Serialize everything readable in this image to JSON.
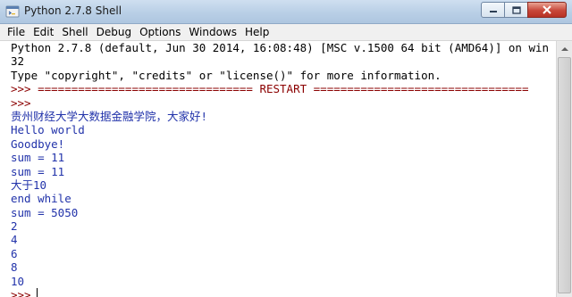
{
  "window": {
    "title": "Python 2.7.8 Shell",
    "icon": "python-shell-icon"
  },
  "menu": [
    "File",
    "Edit",
    "Shell",
    "Debug",
    "Options",
    "Windows",
    "Help"
  ],
  "shell_lines": [
    {
      "text": "Python 2.7.8 (default, Jun 30 2014, 16:08:48) [MSC v.1500 64 bit (AMD64)] on win",
      "kind": "banner"
    },
    {
      "text": "32",
      "kind": "banner"
    },
    {
      "text": "Type \"copyright\", \"credits\" or \"license()\" for more information.",
      "kind": "banner"
    },
    {
      "text": ">>> ================================ RESTART ================================",
      "kind": "prompt"
    },
    {
      "text": ">>>",
      "kind": "prompt"
    },
    {
      "text": "贵州财经大学大数据金融学院，大家好!",
      "kind": "output"
    },
    {
      "text": "Hello world",
      "kind": "output"
    },
    {
      "text": "Goodbye!",
      "kind": "output"
    },
    {
      "text": "sum = 11",
      "kind": "output"
    },
    {
      "text": "sum = 11",
      "kind": "output"
    },
    {
      "text": "大于10",
      "kind": "output"
    },
    {
      "text": "end while",
      "kind": "output"
    },
    {
      "text": "sum = 5050",
      "kind": "output"
    },
    {
      "text": "2",
      "kind": "output"
    },
    {
      "text": "4",
      "kind": "output"
    },
    {
      "text": "6",
      "kind": "output"
    },
    {
      "text": "8",
      "kind": "output"
    },
    {
      "text": "10",
      "kind": "output"
    }
  ],
  "current_prompt": ">>>",
  "colors": {
    "banner": "#000000",
    "prompt": "#8b0000",
    "output": "#2233aa"
  }
}
